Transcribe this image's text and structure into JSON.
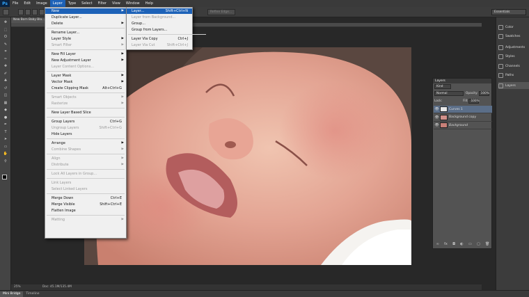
{
  "app": {
    "logo": "Ps"
  },
  "menubar": [
    "File",
    "Edit",
    "Image",
    "Layer",
    "Type",
    "Select",
    "Filter",
    "View",
    "Window",
    "Help"
  ],
  "options": {
    "refine_edge": "Refine Edge...",
    "essentials": "Essentials"
  },
  "document": {
    "tab_title": "New Born Baby Blo...",
    "zoom": "25%",
    "doc_info": "Doc: 45.1M/135.4M"
  },
  "bottom_tabs": [
    "Mini Bridge",
    "Timeline"
  ],
  "dock": [
    "Color",
    "Swatches",
    "Adjustments",
    "Styles",
    "Channels",
    "Paths",
    "Layers"
  ],
  "layers_panel": {
    "title": "Layers",
    "kind": "Kind",
    "blend_mode": "Normal",
    "opacity_label": "Opacity:",
    "opacity": "100%",
    "lock_label": "Lock:",
    "fill_label": "Fill:",
    "fill": "100%",
    "layers": [
      {
        "name": "Curves 1",
        "selected": true
      },
      {
        "name": "Background copy",
        "selected": false
      },
      {
        "name": "Background",
        "selected": false
      }
    ]
  },
  "layer_menu": {
    "items": [
      {
        "label": "New",
        "submenu": true,
        "highlight": true
      },
      {
        "label": "Duplicate Layer..."
      },
      {
        "label": "Delete",
        "submenu": true
      },
      {
        "sep": true
      },
      {
        "label": "Rename Layer..."
      },
      {
        "label": "Layer Style",
        "submenu": true
      },
      {
        "label": "Smart Filter",
        "submenu": true,
        "disabled": true
      },
      {
        "sep": true
      },
      {
        "label": "New Fill Layer",
        "submenu": true
      },
      {
        "label": "New Adjustment Layer",
        "submenu": true
      },
      {
        "label": "Layer Content Options...",
        "disabled": true
      },
      {
        "sep": true
      },
      {
        "label": "Layer Mask",
        "submenu": true
      },
      {
        "label": "Vector Mask",
        "submenu": true
      },
      {
        "label": "Create Clipping Mask",
        "shortcut": "Alt+Ctrl+G"
      },
      {
        "sep": true
      },
      {
        "label": "Smart Objects",
        "submenu": true,
        "disabled": true
      },
      {
        "label": "Rasterize",
        "submenu": true,
        "disabled": true
      },
      {
        "sep": true
      },
      {
        "label": "New Layer Based Slice"
      },
      {
        "sep": true
      },
      {
        "label": "Group Layers",
        "shortcut": "Ctrl+G"
      },
      {
        "label": "Ungroup Layers",
        "shortcut": "Shift+Ctrl+G",
        "disabled": true
      },
      {
        "label": "Hide Layers"
      },
      {
        "sep": true
      },
      {
        "label": "Arrange",
        "submenu": true
      },
      {
        "label": "Combine Shapes",
        "submenu": true,
        "disabled": true
      },
      {
        "sep": true
      },
      {
        "label": "Align",
        "submenu": true,
        "disabled": true
      },
      {
        "label": "Distribute",
        "submenu": true,
        "disabled": true
      },
      {
        "sep": true
      },
      {
        "label": "Lock All Layers in Group...",
        "disabled": true
      },
      {
        "sep": true
      },
      {
        "label": "Link Layers",
        "disabled": true
      },
      {
        "label": "Select Linked Layers",
        "disabled": true
      },
      {
        "sep": true
      },
      {
        "label": "Merge Down",
        "shortcut": "Ctrl+E"
      },
      {
        "label": "Merge Visible",
        "shortcut": "Shift+Ctrl+E"
      },
      {
        "label": "Flatten Image"
      },
      {
        "sep": true
      },
      {
        "label": "Matting",
        "submenu": true,
        "disabled": true
      }
    ]
  },
  "new_submenu": {
    "items": [
      {
        "label": "Layer...",
        "shortcut": "Shift+Ctrl+N",
        "highlight": true
      },
      {
        "label": "Layer from Background...",
        "disabled": true
      },
      {
        "label": "Group..."
      },
      {
        "label": "Group from Layers..."
      },
      {
        "sep": true
      },
      {
        "label": "Layer Via Copy",
        "shortcut": "Ctrl+J"
      },
      {
        "label": "Layer Via Cut",
        "shortcut": "Shift+Ctrl+J",
        "disabled": true
      }
    ]
  }
}
